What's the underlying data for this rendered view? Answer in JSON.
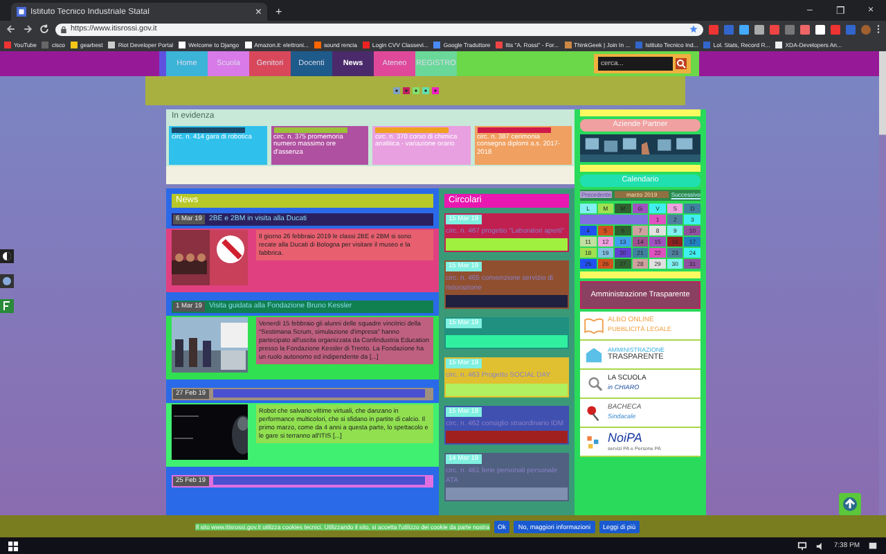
{
  "browser": {
    "tab_title": "Istituto Tecnico Industriale Statal",
    "tab_close": "×",
    "new_tab": "+",
    "window_controls": [
      "–",
      "❐",
      "×"
    ],
    "url": "https://www.itisrossi.gov.it",
    "bookmarks": [
      "YouTube",
      "cisco",
      "gearbest",
      "Riot Developer Portal",
      "Welcome to Django",
      "Amazon.it: elettroni...",
      "sound rencia",
      "Login CVV Classevi...",
      "Google Traduttore",
      "Itis \"A. Rossi\" - For...",
      "ThinkGeek | Join In ...",
      "Istituto Tecnico Ind...",
      "Lol. Stats, Record R...",
      "XDA-Developers An..."
    ]
  },
  "nav": {
    "items": [
      {
        "label": "Home",
        "selected": false
      },
      {
        "label": "Scuola",
        "selected": false
      },
      {
        "label": "Genitori",
        "selected": false
      },
      {
        "label": "Docenti",
        "selected": false
      },
      {
        "label": "News",
        "selected": true
      },
      {
        "label": "Ateneo",
        "selected": false
      },
      {
        "label": "REGISTRO",
        "selected": false
      }
    ],
    "search": {
      "placeholder": "cerca..."
    }
  },
  "in_evidenza": {
    "title": "In evidenza",
    "items": [
      "circ. n. 414 gara di robotica",
      "circ. n. 375 promemoria numero massimo ore d'assenza",
      "circ. n. 370 corso di chimica analitica - variazione orario",
      "circ. n. 387 cerimonia consegna diplomi a.s. 2017-2018"
    ]
  },
  "news": {
    "title": "News",
    "items": [
      {
        "date": "6 Mar 19",
        "title": "2BE e 2BM in visita alla Ducati",
        "text": "Il giorno 26 febbraio 2019 le classi 2BE e 2BM si sono recate alla Ducati di Bologna per visitare il museo e la fabbrica."
      },
      {
        "date": "1 Mar 19",
        "title": "Visita guidata alla Fondazione Bruno Kessler",
        "text": "Venerdì 15 febbraio gli alunni delle squadre vincitrici della \"Sestimana Scrum, simulazione d'impresa\" hanno partecipato all'uscita organizzata da Confindustria Education presso la Fondazione Kessler di Trento. La Fondazione ha un ruolo autonomo ed indipendente da [...]"
      },
      {
        "date": "27 Feb 19",
        "text": "Robot che salvano vittime virtuali, che danzano in performance multicolori, che si sfidano in partite di calcio. Il primo marzo, come da 4 anni a questa parte, lo spettacolo e le gare si terranno all'ITIS [...]"
      },
      {
        "date": "25 Feb 19"
      }
    ]
  },
  "circolari": {
    "title": "Circolari",
    "items": [
      {
        "date": "15 Mar 19",
        "title": "circ. n. 467 progetto \"Laboratori aperti\""
      },
      {
        "date": "15 Mar 19",
        "title": "circ. n. 465 convenzione servizio di ristorazione"
      },
      {
        "date": "15 Mar 19"
      },
      {
        "date": "15 Mar 19",
        "title": "circ. n. 463 Progetto SOCIAL DAY"
      },
      {
        "date": "15 Mar 19",
        "title": "circ. n. 462 consiglio straordinario IDM"
      },
      {
        "date": "14 Mar 19",
        "title": "circ. n. 461 ferie personali personale ATA"
      }
    ]
  },
  "sidebar": {
    "partner_title": "Aziende Partner",
    "calendar_title": "Calendario",
    "calendar": {
      "prev": "Precedente",
      "month": "marzo 2019",
      "next": "Successivo",
      "weekdays": [
        "L",
        "M",
        "M",
        "G",
        "V",
        "S",
        "D"
      ],
      "days": [
        "1",
        "2",
        "3",
        "4",
        "5",
        "6",
        "7",
        "8",
        "9",
        "10",
        "11",
        "12",
        "13",
        "14",
        "15",
        "16",
        "17",
        "18",
        "19",
        "20",
        "21",
        "22",
        "23",
        "24",
        "25",
        "26",
        "27",
        "28",
        "29",
        "30",
        "31"
      ]
    },
    "amministrazione": "Amministrazione Trasparente",
    "banners": [
      {
        "kind": "albo",
        "line1": "ALBO ONLINE",
        "line2": "PUBBLICITÀ LEGALE"
      },
      {
        "kind": "amm",
        "line1": "AMMINISTRAZIONE",
        "line2": "TRASPARENTE"
      },
      {
        "kind": "chiaro",
        "line1": "LA SCUOLA",
        "line2": "in CHIARO"
      },
      {
        "kind": "bacheca",
        "line1": "BACHECA",
        "line2": "Sindacale"
      },
      {
        "kind": "noipa",
        "line1": "NoiPA",
        "line2": "servizi PA e Persone PA"
      }
    ]
  },
  "cookie_bar": {
    "text": "Il sito www.itisrossi.gov.it utilizza cookies tecnici. Utilizzando il sito, si accetta l'utilizzo dei cookie da parte nostra",
    "buttons": [
      "Ok",
      "No, maggiori informazioni",
      "Leggi di più"
    ]
  },
  "taskbar": {
    "time": "7:38 PM"
  }
}
